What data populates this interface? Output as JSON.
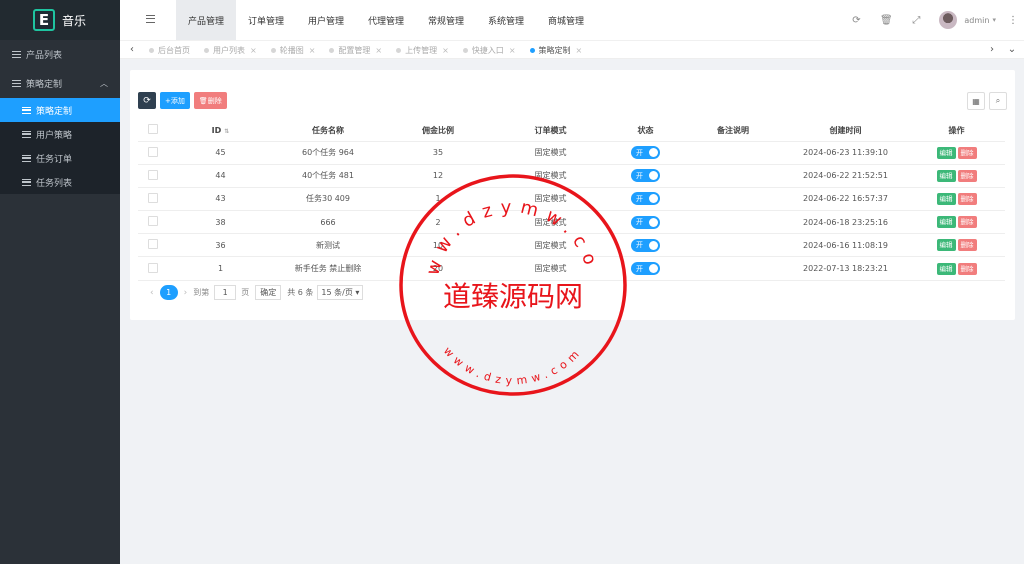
{
  "app": {
    "logo_letter": "E",
    "title": "音乐"
  },
  "sidebar": {
    "items": [
      {
        "label": "产品列表"
      },
      {
        "label": "策略定制",
        "expanded": true
      }
    ],
    "submenu": [
      {
        "label": "策略定制",
        "active": true
      },
      {
        "label": "用户策略"
      },
      {
        "label": "任务订单"
      },
      {
        "label": "任务列表"
      }
    ]
  },
  "header": {
    "nav": [
      "产品管理",
      "订单管理",
      "用户管理",
      "代理管理",
      "常规管理",
      "系统管理",
      "商城管理"
    ],
    "active_nav": "产品管理",
    "user": "admin"
  },
  "tabs": [
    {
      "label": "后台首页",
      "closable": false
    },
    {
      "label": "用户列表",
      "closable": true
    },
    {
      "label": "轮播图",
      "closable": true
    },
    {
      "label": "配置管理",
      "closable": true
    },
    {
      "label": "上传管理",
      "closable": true
    },
    {
      "label": "快捷入口",
      "closable": true
    },
    {
      "label": "策略定制",
      "closable": true,
      "active": true
    }
  ],
  "toolbar": {
    "add_label": "添加",
    "delete_label": "删除"
  },
  "table": {
    "columns": [
      "ID",
      "任务名称",
      "佣金比例",
      "订单模式",
      "状态",
      "备注说明",
      "创建时间",
      "操作"
    ],
    "rows": [
      {
        "id": "45",
        "name": "60个任务 964",
        "ratio": "35",
        "mode": "固定模式",
        "status": "开",
        "remark": "",
        "created": "2024-06-23 11:39:10"
      },
      {
        "id": "44",
        "name": "40个任务 481",
        "ratio": "12",
        "mode": "固定模式",
        "status": "开",
        "remark": "",
        "created": "2024-06-22 21:52:51"
      },
      {
        "id": "43",
        "name": "任务30 409",
        "ratio": "1",
        "mode": "固定模式",
        "status": "开",
        "remark": "",
        "created": "2024-06-22 16:57:37"
      },
      {
        "id": "38",
        "name": "666",
        "ratio": "2",
        "mode": "固定模式",
        "status": "开",
        "remark": "",
        "created": "2024-06-18 23:25:16"
      },
      {
        "id": "36",
        "name": "新测试",
        "ratio": "10",
        "mode": "固定模式",
        "status": "开",
        "remark": "",
        "created": "2024-06-16 11:08:19"
      },
      {
        "id": "1",
        "name": "新手任务 禁止删除",
        "ratio": "20",
        "mode": "固定模式",
        "status": "开",
        "remark": "",
        "created": "2022-07-13 18:23:21"
      }
    ],
    "edit_label": "编辑",
    "delete_label": "删除"
  },
  "pager": {
    "current": "1",
    "goto_label": "到第",
    "goto_value": "1",
    "page_unit": "页",
    "ok_label": "确定",
    "total": "共 6 条",
    "page_size": "15 条/页"
  },
  "watermark": {
    "center": "道臻源码网",
    "ring_top": "www.dzymw.com",
    "ring_bottom": "www.dzymw.com",
    "color": "#e8151b"
  }
}
